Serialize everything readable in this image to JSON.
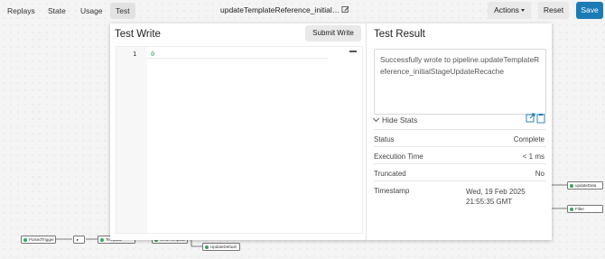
{
  "toolbar": {
    "tabs": [
      "Replays",
      "State",
      "Usage",
      "Test"
    ],
    "active_tab": "Test",
    "pipeline_title": "updateTemplateReference_initial…",
    "actions_label": "Actions",
    "reset_label": "Reset",
    "save_label": "Save"
  },
  "test_write": {
    "title": "Test Write",
    "submit_label": "Submit Write",
    "editor": {
      "line_number": "1",
      "code": "0"
    }
  },
  "test_result": {
    "title": "Test Result",
    "message": "Successfully wrote to pipeline.updateTemplateReference_initialStageUpdateRecache",
    "hide_stats_label": "Hide Stats",
    "stats": [
      {
        "key": "Status",
        "value": "Complete"
      },
      {
        "key": "Execution Time",
        "value": "< 1 ms"
      },
      {
        "key": "Truncated",
        "value": "No"
      },
      {
        "key": "Timestamp",
        "value": "Wed, 19 Feb 2025 21:55:35 GMT"
      }
    ]
  },
  "canvas": {
    "nodes": [
      "PulsedTrigger",
      "▸",
      "Template",
      "WriteTemplate",
      "UpdateDefault",
      "updateData",
      "Filter"
    ]
  },
  "colors": {
    "accent": "#1a7bb5",
    "node_status": "#3aa55d",
    "code": "#2a9d5c"
  }
}
